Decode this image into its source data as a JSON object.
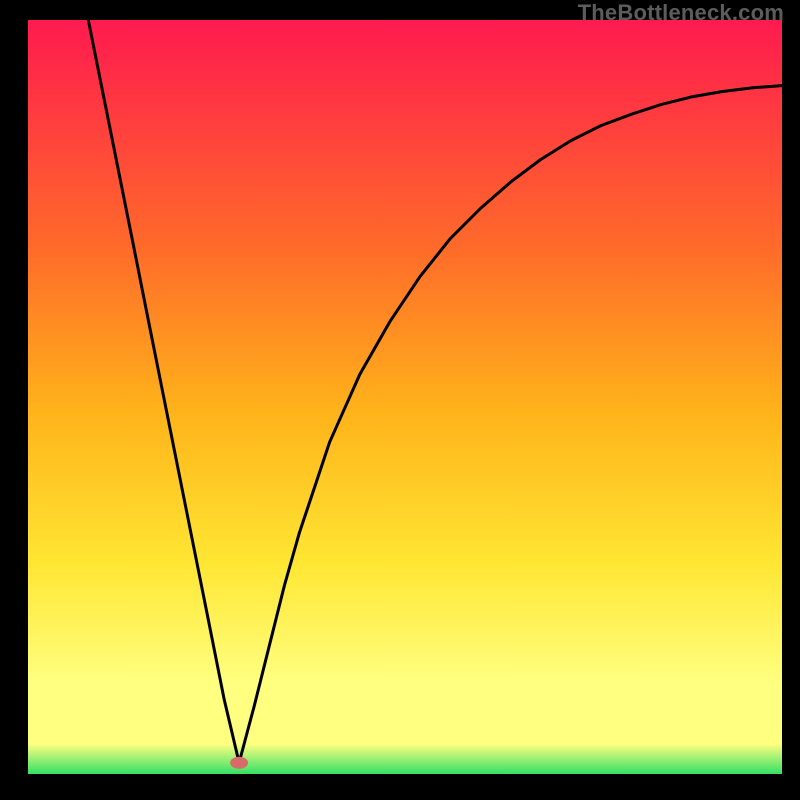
{
  "watermark": "TheBottleneck.com",
  "colors": {
    "top": "#ff1a4f",
    "mid1": "#ff6a2a",
    "mid2": "#ffb31a",
    "mid3": "#ffe633",
    "lower": "#ffff80",
    "green": "#33e066",
    "curve": "#000000",
    "marker": "#d86a6a"
  },
  "chart_data": {
    "type": "line",
    "title": "",
    "xlabel": "",
    "ylabel": "",
    "xlim": [
      0,
      100
    ],
    "ylim": [
      0,
      100
    ],
    "annotations": [
      {
        "label": "minimum-marker",
        "x": 28,
        "y": 1.5
      }
    ],
    "series": [
      {
        "name": "bottleneck-curve",
        "x": [
          8,
          10,
          12,
          14,
          16,
          18,
          20,
          22,
          24,
          26,
          28,
          30,
          32,
          34,
          36,
          38,
          40,
          44,
          48,
          52,
          56,
          60,
          64,
          68,
          72,
          76,
          80,
          84,
          88,
          92,
          96,
          100
        ],
        "values": [
          100,
          90,
          80,
          70,
          60,
          50,
          40,
          30,
          20,
          10,
          1.5,
          9,
          17,
          25,
          32,
          38,
          44,
          53,
          60,
          66,
          71,
          75,
          78.5,
          81.5,
          84,
          86,
          87.5,
          88.8,
          89.8,
          90.5,
          91,
          91.3
        ]
      }
    ]
  }
}
